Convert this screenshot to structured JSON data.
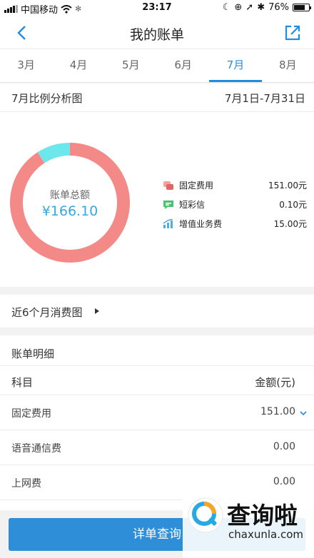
{
  "status_bar": {
    "carrier": "中国移动",
    "time": "23:17",
    "battery": "76%",
    "battery_level": 0.76
  },
  "nav": {
    "title": "我的账单",
    "back_icon": "back-chevron-icon",
    "share_icon": "share-icon"
  },
  "tabs": [
    {
      "label": "3月"
    },
    {
      "label": "4月"
    },
    {
      "label": "5月"
    },
    {
      "label": "6月"
    },
    {
      "label": "7月",
      "active": true
    },
    {
      "label": "8月"
    }
  ],
  "ratio": {
    "title": "7月比例分析图",
    "range": "7月1日-7月31日"
  },
  "donut": {
    "label": "账单总额",
    "value": "¥166.10"
  },
  "chart_data": {
    "type": "pie",
    "categories": [
      "固定费用",
      "短彩信",
      "增值业务费"
    ],
    "values": [
      151.0,
      0.1,
      15.0
    ],
    "value_labels": [
      "151.00元",
      "0.10元",
      "15.00元"
    ],
    "colors": [
      "#f48a88",
      "#f48a88",
      "#6ee7ec"
    ],
    "legend_placement": "right"
  },
  "legend_icons": [
    "fixed-fee-icon",
    "sms-icon",
    "value-added-icon"
  ],
  "trend": {
    "label": "近6个月消费图"
  },
  "detail": {
    "title": "账单明细",
    "header": {
      "item": "科目",
      "amount": "金额(元)"
    },
    "rows": [
      {
        "item": "固定费用",
        "amount": "151.00"
      },
      {
        "item": "语音通信费",
        "amount": "0.00"
      },
      {
        "item": "上网费",
        "amount": "0.00"
      }
    ]
  },
  "button": {
    "label": "详单查询"
  },
  "watermark": {
    "cn": "查询啦",
    "en": "chaxunla.com"
  },
  "colors": {
    "accent": "#1f8ee0",
    "button": "#2e8ed8",
    "donut_main": "#f48a88",
    "donut_secondary": "#6ee7ec"
  }
}
